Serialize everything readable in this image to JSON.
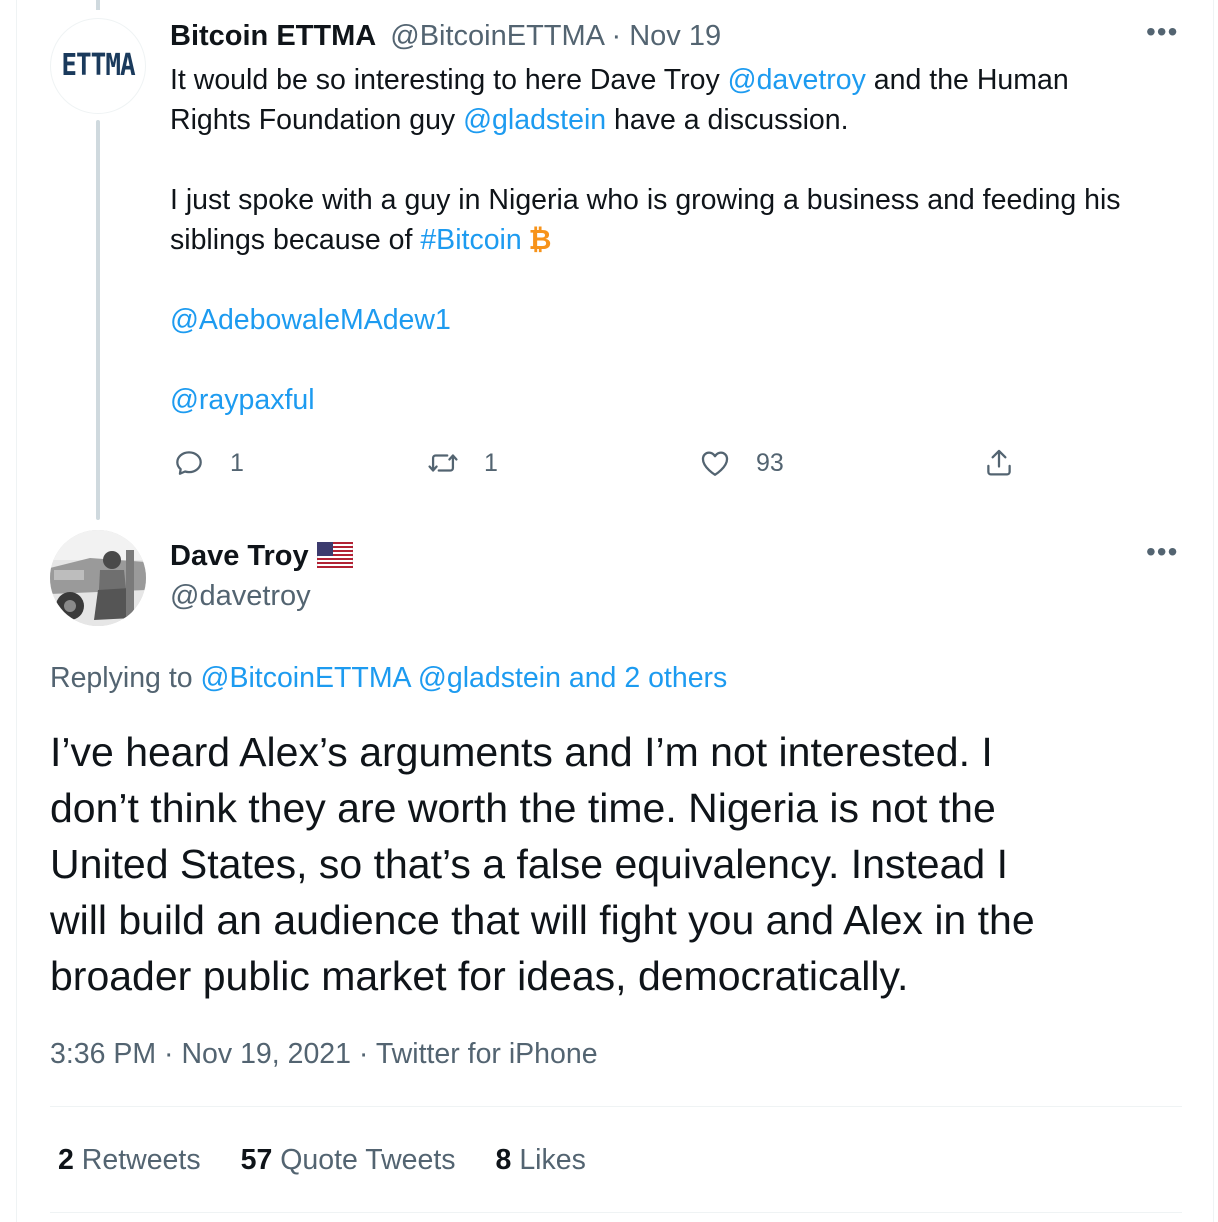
{
  "parent_tweet": {
    "avatar_text": "ETTMA",
    "name": "Bitcoin ETTMA",
    "handle": "@BitcoinETTMA",
    "separator": " · ",
    "date": "Nov 19",
    "more_icon": "more-horizontal-icon",
    "body": {
      "l1_a": "It would be so interesting to here Dave Troy ",
      "l1_link": "@davetroy",
      "l1_b": " and the Human",
      "l2_a": "Rights Foundation guy ",
      "l2_link": "@gladstein",
      "l2_b": " have a discussion.",
      "l3": "I just spoke with a guy in Nigeria who is growing a business and feeding his",
      "l4_a": "siblings because of ",
      "l4_link": "#Bitcoin",
      "l4_icon": "bitcoin-icon",
      "l5_link": "@AdebowaleMAdew1",
      "l6_link": "@raypaxful"
    },
    "actions": {
      "reply_count": "1",
      "retweet_count": "1",
      "like_count": "93"
    }
  },
  "main_tweet": {
    "name": "Dave Troy",
    "flag_icon": "us-flag-icon",
    "handle": "@davetroy",
    "replying_prefix": "Replying to ",
    "replying_users": "@BitcoinETTMA @gladstein and 2 others",
    "text_lines": [
      "I’ve heard Alex’s arguments and I’m not interested. I",
      "don’t think they are worth the time. Nigeria is not the",
      "United States, so that’s a false equivalency. Instead I",
      "will build an audience that will fight you and Alex in the",
      "broader public market for ideas, democratically."
    ],
    "timestamp": "3:36 PM · Nov 19, 2021 · Twitter for iPhone",
    "stats": {
      "retweets_count": "2",
      "retweets_label": " Retweets",
      "quotes_count": "57",
      "quotes_label": " Quote Tweets",
      "likes_count": "8",
      "likes_label": " Likes"
    }
  },
  "colors": {
    "link": "#1d9bf0",
    "secondary_text": "#536471",
    "primary_text": "#0f1419",
    "bitcoin": "#f7931a",
    "divider": "#eff3f4"
  }
}
